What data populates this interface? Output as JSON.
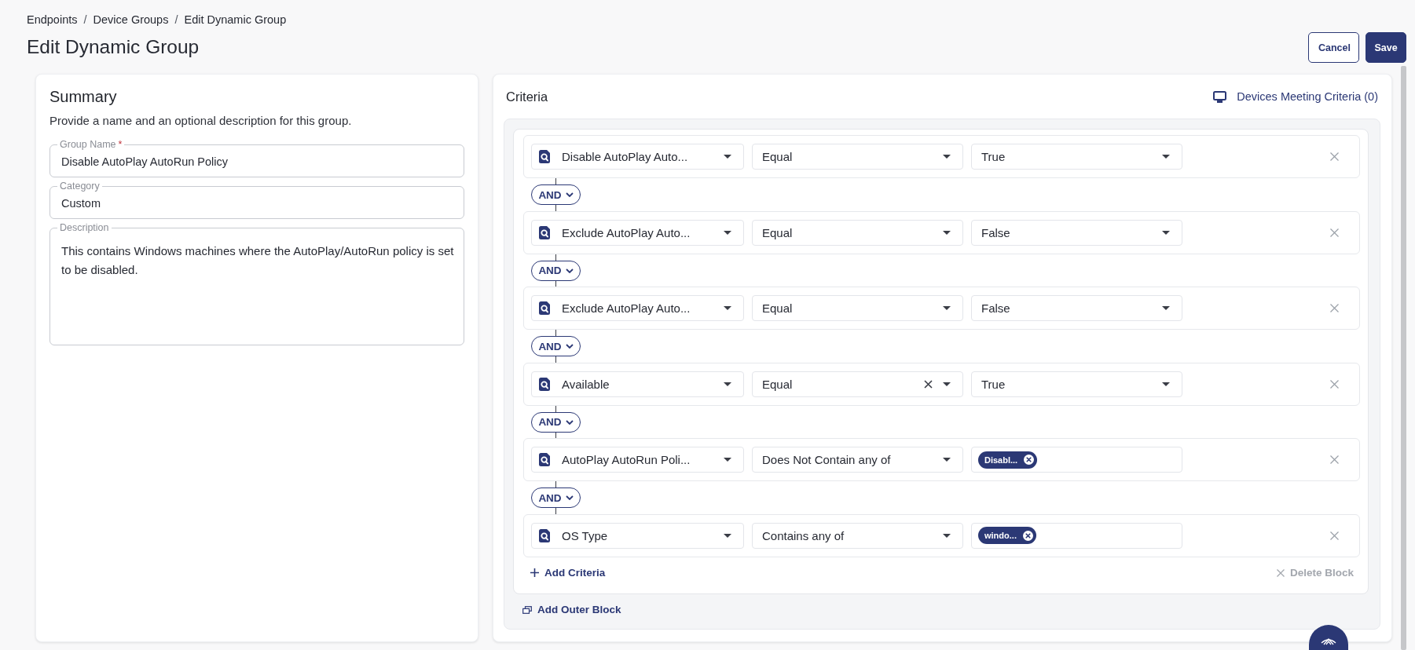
{
  "breadcrumb": [
    {
      "label": "Endpoints",
      "separator": "/"
    },
    {
      "label": "Device Groups",
      "separator": "/"
    },
    {
      "label": "Edit Dynamic Group"
    }
  ],
  "page_title": "Edit Dynamic Group",
  "actions": [
    {
      "label": "Cancel",
      "kind": "secondary"
    },
    {
      "label": "Save",
      "kind": "primary"
    }
  ],
  "summary": {
    "title": "Summary",
    "description": "Provide a name and an optional description for this group.",
    "fields": [
      {
        "kind": "text",
        "label": "Group Name",
        "required_mark": "*",
        "value": "Disable AutoPlay AutoRun Policy"
      },
      {
        "kind": "text",
        "label": "Category",
        "value": "Custom"
      },
      {
        "kind": "textarea",
        "label": "Description",
        "value": "This contains Windows machines where the AutoPlay/AutoRun policy is set to be disabled."
      }
    ]
  },
  "criteria": {
    "title": "Criteria",
    "devices_link": "Devices Meeting Criteria (0)",
    "rules": [
      {
        "attribute": "Disable AutoPlay Auto...",
        "operator": "Equal",
        "operator_clearable": false,
        "kind": "select",
        "value": "True"
      },
      {
        "attribute": "Exclude AutoPlay Auto...",
        "operator": "Equal",
        "operator_clearable": false,
        "kind": "select",
        "value": "False"
      },
      {
        "attribute": "Exclude AutoPlay Auto...",
        "operator": "Equal",
        "operator_clearable": false,
        "kind": "select",
        "value": "False"
      },
      {
        "attribute": "Available",
        "operator": "Equal",
        "operator_clearable": true,
        "kind": "select",
        "value": "True"
      },
      {
        "attribute": "AutoPlay AutoRun Poli...",
        "operator": "Does Not Contain any of",
        "operator_clearable": false,
        "kind": "tags",
        "tags": [
          "Disabl..."
        ]
      },
      {
        "attribute": "OS Type",
        "operator": "Contains any of",
        "operator_clearable": false,
        "kind": "tags",
        "tags": [
          "windo..."
        ]
      }
    ],
    "connectors": [
      "AND",
      "AND",
      "AND",
      "AND",
      "AND"
    ],
    "add_criteria": "Add Criteria",
    "delete_block": {
      "label": "Delete Block",
      "disabled": true
    },
    "add_outer_block": "Add Outer Block"
  }
}
